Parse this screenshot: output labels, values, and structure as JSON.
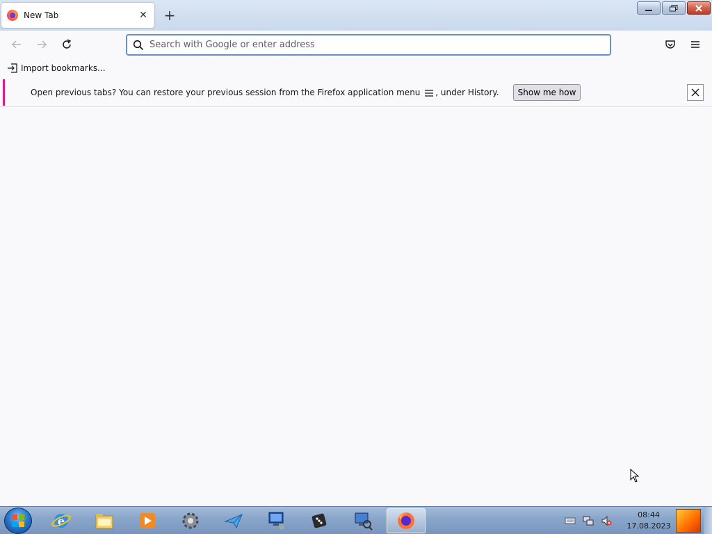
{
  "tab": {
    "title": "New Tab",
    "close_glyph": "✕",
    "new_tab_glyph": "+"
  },
  "window_controls": {
    "minimize": "▁",
    "maximize": "❐",
    "close": "✕"
  },
  "navbar": {
    "url_placeholder": "Search with Google or enter address",
    "url_value": ""
  },
  "bookmarks": {
    "import_label": "Import bookmarks..."
  },
  "notification": {
    "text_before": "Open previous tabs? You can restore your previous session from the Firefox application menu",
    "text_after": ", under History.",
    "button_label": "Show me how",
    "accent_color": "#e31587"
  },
  "taskbar": {
    "time": "08:44",
    "date": "17.08.2023",
    "apps": [
      "internet-explorer-icon",
      "file-explorer-icon",
      "media-player-icon",
      "settings-gear-icon",
      "paper-plane-icon",
      "network-computer-icon",
      "dice-game-icon",
      "computer-search-icon",
      "firefox-icon"
    ]
  },
  "colors": {
    "urlbar_border": "#6a8fc6",
    "taskbar": "#8aa7cb"
  }
}
